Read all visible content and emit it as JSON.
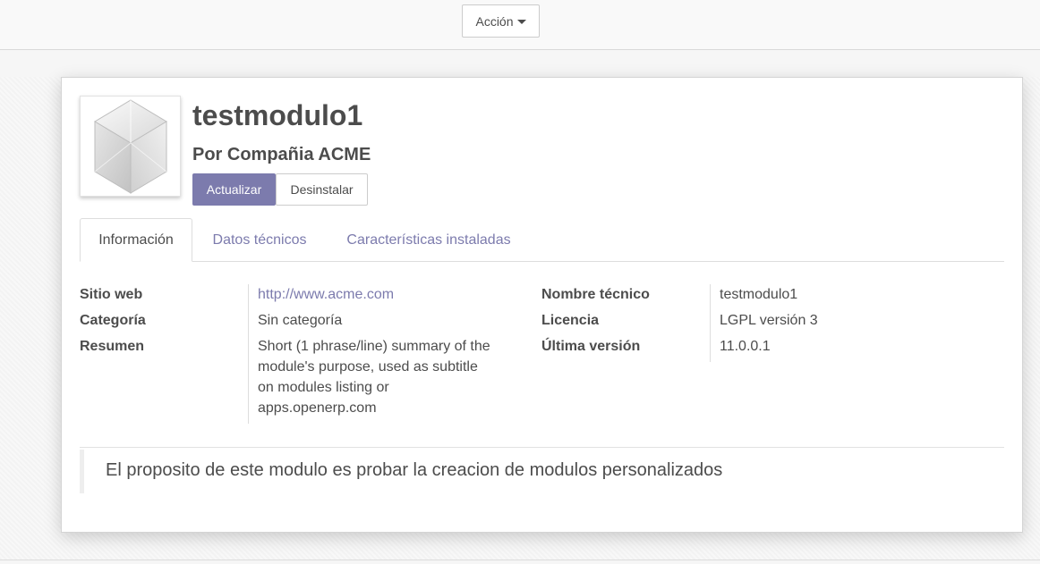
{
  "control_panel": {
    "action_label": "Acción"
  },
  "module": {
    "name": "testmodulo1",
    "author": "Por Compañia ACME",
    "image_icon": "module-cube-icon"
  },
  "buttons": {
    "upgrade": "Actualizar",
    "uninstall": "Desinstalar"
  },
  "tabs": [
    {
      "label": "Información",
      "active": true
    },
    {
      "label": "Datos técnicos",
      "active": false
    },
    {
      "label": "Características instaladas",
      "active": false
    }
  ],
  "left_fields": [
    {
      "label": "Sitio web",
      "value": "http://www.acme.com"
    },
    {
      "label": "Categoría",
      "value": "Sin categoría"
    },
    {
      "label": "Resumen",
      "value": "Short (1 phrase/line) summary of the module's purpose, used as subtitle on modules listing or apps.openerp.com"
    }
  ],
  "summary_lines": [
    "Short (1 phrase/line) summary of the",
    "module's purpose, used as subtitle",
    "on modules listing or",
    "apps.openerp.com"
  ],
  "right_fields": [
    {
      "label": "Nombre técnico",
      "value": "testmodulo1"
    },
    {
      "label": "Licencia",
      "value": "LGPL versión 3"
    },
    {
      "label": "Última versión",
      "value": "11.0.0.1"
    }
  ],
  "description": "El proposito de este modulo es probar la creacion de modulos personalizados",
  "colors": {
    "primary": "#7c7bad",
    "text": "#4c4c4c",
    "border": "#dddddd"
  }
}
